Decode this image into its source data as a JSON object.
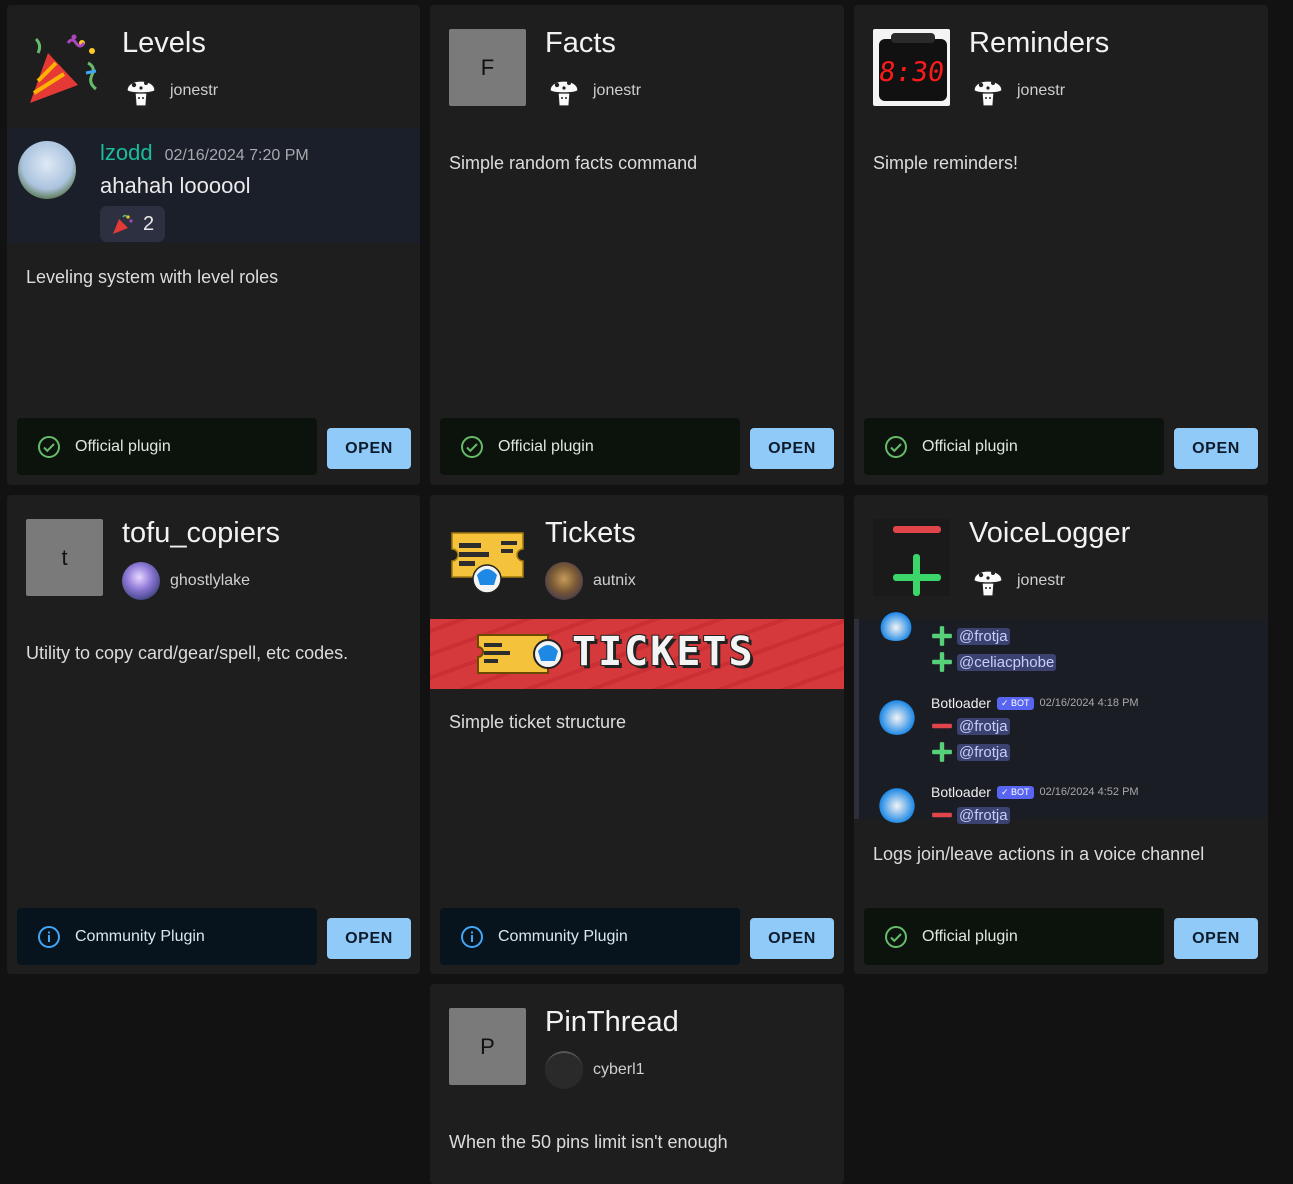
{
  "open_label": "OPEN",
  "official_label": "Official plugin",
  "community_label": "Community Plugin",
  "plugins": [
    {
      "title": "Levels",
      "author": "jonestr",
      "thumb_icon": "party-popper-icon",
      "description": "Leveling system with level roles",
      "badge": "official",
      "preview": {
        "username": "lzodd",
        "timestamp": "02/16/2024 7:20 PM",
        "message": "ahahah loooool",
        "reaction_count": "2",
        "reaction_icon": "party-popper-icon"
      }
    },
    {
      "title": "Facts",
      "author": "jonestr",
      "thumb_letter": "F",
      "description": "Simple random facts command",
      "badge": "official"
    },
    {
      "title": "Reminders",
      "author": "jonestr",
      "thumb_icon": "alarm-clock-icon",
      "clock_text": "8:30",
      "description": "Simple reminders!",
      "badge": "official"
    },
    {
      "title": "tofu_copiers",
      "author": "ghostlylake",
      "thumb_letter": "t",
      "description": "Utility to copy card/gear/spell, etc codes.",
      "badge": "community"
    },
    {
      "title": "Tickets",
      "author": "autnix",
      "thumb_icon": "ticket-icon",
      "banner_text": "TICKETS",
      "description": "Simple ticket structure",
      "badge": "community"
    },
    {
      "title": "VoiceLogger",
      "author": "jonestr",
      "thumb_icon": "minus-plus-icon",
      "description": "Logs join/leave actions in a voice channel",
      "badge": "official",
      "preview": {
        "top_mentions": [
          "@frotja",
          "@celiacphobe"
        ],
        "messages": [
          {
            "name": "Botloader",
            "bot_tag": "BOT",
            "timestamp": "02/16/2024 4:18 PM",
            "lines": [
              {
                "sign": "minus",
                "mention": "@frotja"
              },
              {
                "sign": "plus",
                "mention": "@frotja"
              }
            ]
          },
          {
            "name": "Botloader",
            "bot_tag": "BOT",
            "timestamp": "02/16/2024 4:52 PM",
            "lines": [
              {
                "sign": "minus",
                "mention": "@frotja"
              }
            ]
          }
        ]
      }
    },
    {
      "title": "PinThread",
      "author": "cyberl1",
      "thumb_letter": "P",
      "description": "When the 50 pins limit isn't enough"
    }
  ],
  "colors": {
    "page_bg": "#121212",
    "card_bg": "#1e1e1e",
    "open_button": "#90caf9",
    "official_check": "#66bb6a",
    "community_info": "#42a5f5",
    "username_green": "#1abc9c",
    "bot_badge": "#5865f2"
  }
}
